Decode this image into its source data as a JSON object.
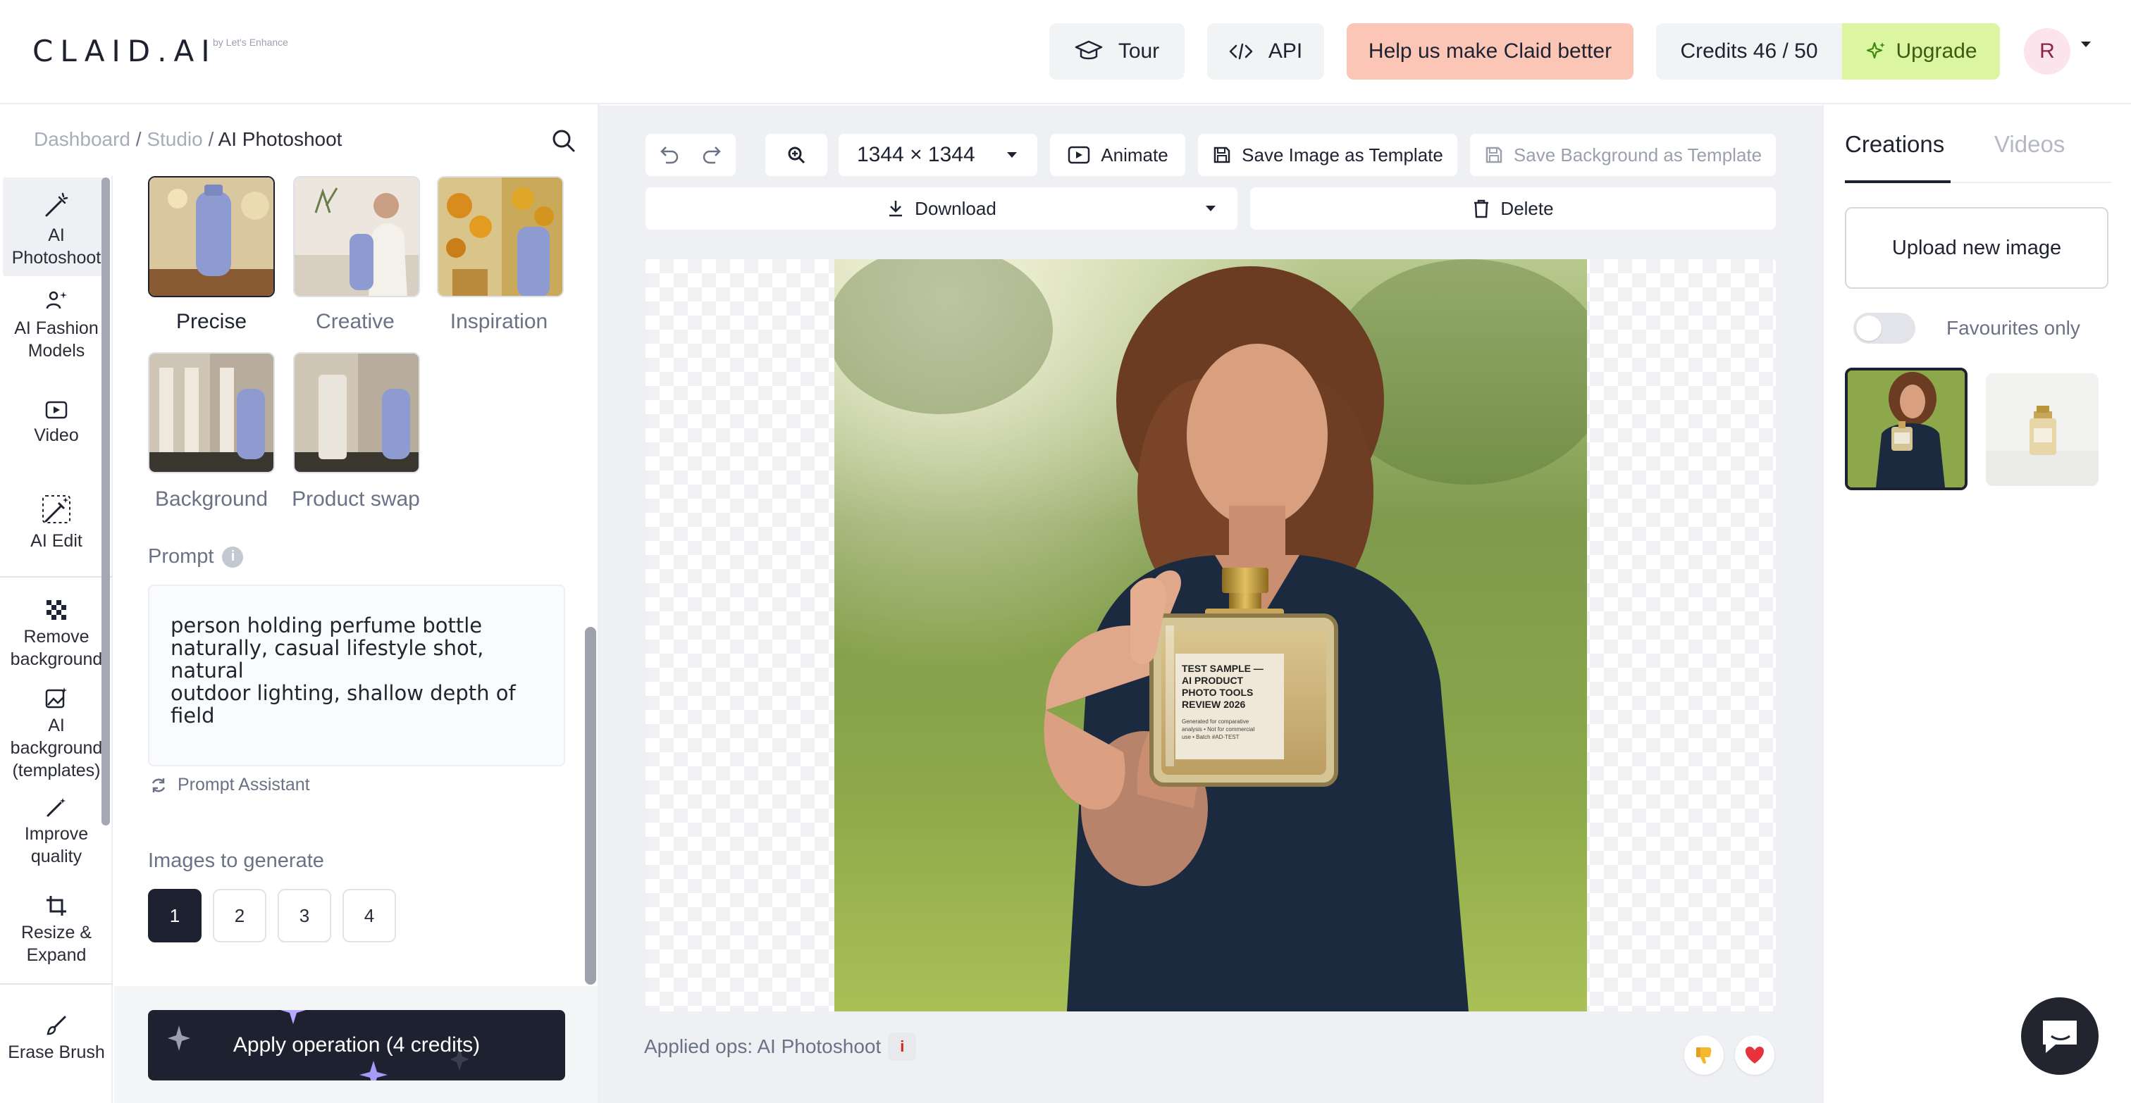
{
  "header": {
    "logo": "CLAID.AI",
    "logo_sub": "by Let's Enhance",
    "tour_label": "Tour",
    "api_label": "API",
    "help_label": "Help us make Claid better",
    "credits_label": "Credits 46 / 50",
    "upgrade_label": "Upgrade",
    "avatar_initial": "R",
    "help_color": "#fbc6b6",
    "upgrade_color": "#dcf5a0"
  },
  "breadcrumb": {
    "items": [
      "Dashboard",
      "Studio",
      "AI Photoshoot"
    ],
    "separator": " / "
  },
  "tools": [
    {
      "label": "AI Photoshoot",
      "icon": "magic-wand-icon",
      "active": true
    },
    {
      "label": "AI Fashion Models",
      "icon": "sparkle-person-icon",
      "active": false
    },
    {
      "label": "Video",
      "icon": "play-icon",
      "active": false
    },
    {
      "label": "AI Edit",
      "icon": "magic-edit-icon",
      "active": false
    },
    {
      "label": "Remove background",
      "icon": "checkerboard-icon",
      "active": false
    },
    {
      "label": "AI background (templates)",
      "icon": "image-sparkle-icon",
      "active": false
    },
    {
      "label": "Improve quality",
      "icon": "wand-icon",
      "active": false
    },
    {
      "label": "Resize & Expand",
      "icon": "crop-icon",
      "active": false
    },
    {
      "label": "Erase Brush",
      "icon": "brush-icon",
      "active": false
    }
  ],
  "modes": [
    {
      "label": "Precise",
      "selected": true
    },
    {
      "label": "Creative",
      "selected": false
    },
    {
      "label": "Inspiration",
      "selected": false
    },
    {
      "label": "Background",
      "selected": false
    },
    {
      "label": "Product swap",
      "selected": false
    }
  ],
  "prompt": {
    "label": "Prompt",
    "text": "person holding perfume bottle\nnaturally, casual lifestyle shot, natural\noutdoor lighting, shallow depth of field",
    "assistant_label": "Prompt Assistant"
  },
  "images_to_generate": {
    "label": "Images to generate",
    "options": [
      "1",
      "2",
      "3",
      "4"
    ],
    "selected": "1"
  },
  "apply_label": "Apply operation (4 credits)",
  "toolbar": {
    "size_label": "1344 × 1344",
    "animate_label": "Animate",
    "save_image_template_label": "Save Image as Template",
    "save_bg_template_label": "Save Background as Template",
    "download_label": "Download",
    "delete_label": "Delete"
  },
  "canvas": {
    "bottle_label_lines": [
      "TEST SAMPLE —",
      "AI PRODUCT",
      "PHOTO TOOLS",
      "REVIEW 2026"
    ],
    "bottle_small_lines": [
      "Generated for comparative",
      "analysis • Not for commercial",
      "use • Batch #AD-TEST"
    ]
  },
  "applied_ops": "Applied ops: AI Photoshoot",
  "right_panel": {
    "tabs": [
      "Creations",
      "Videos"
    ],
    "active_tab": "Creations",
    "upload_label": "Upload new image",
    "favourites_label": "Favourites only",
    "favourites_on": false
  }
}
